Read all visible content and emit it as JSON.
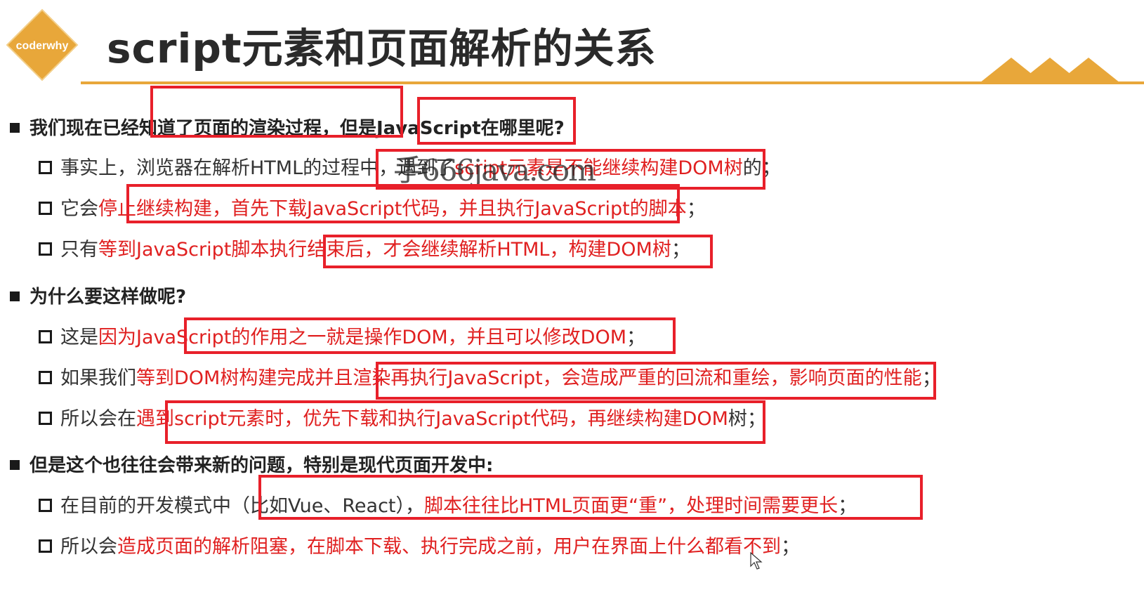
{
  "header": {
    "logo_text": "coderwhy",
    "title": "script元素和页面解析的关系"
  },
  "bullets": [
    {
      "text": "我们现在已经知道了页面的渲染过程，但是JavaScript在哪里呢?",
      "subs": [
        {
          "segments": [
            {
              "text": "事实上，浏览器在解析HTML的过程中，遇到了",
              "style": "dark"
            },
            {
              "text": "script元素是不能继续构建DOM树",
              "style": "red"
            },
            {
              "text": "的；",
              "style": "dark"
            }
          ]
        },
        {
          "segments": [
            {
              "text": "它会",
              "style": "dark"
            },
            {
              "text": "停止继续构建，首先下载JavaScript代码，并且执行JavaScript的脚本",
              "style": "red"
            },
            {
              "text": "；",
              "style": "dark"
            }
          ]
        },
        {
          "segments": [
            {
              "text": "只有",
              "style": "dark"
            },
            {
              "text": "等到JavaScript脚本执行结束后，才会继续解析HTML，构建DOM树",
              "style": "red"
            },
            {
              "text": "；",
              "style": "dark"
            }
          ]
        }
      ]
    },
    {
      "text": "为什么要这样做呢?",
      "subs": [
        {
          "segments": [
            {
              "text": "这是",
              "style": "dark"
            },
            {
              "text": "因为JavaScript的作用之一就是操作DOM，并且可以修改DOM",
              "style": "red"
            },
            {
              "text": "；",
              "style": "dark"
            }
          ]
        },
        {
          "segments": [
            {
              "text": "如果我们",
              "style": "dark"
            },
            {
              "text": "等到DOM树构建完成并且渲染再执行JavaScript，会造成严重的回流和重绘，影响页面的性能",
              "style": "red"
            },
            {
              "text": "；",
              "style": "dark"
            }
          ]
        },
        {
          "segments": [
            {
              "text": "所以会在",
              "style": "dark"
            },
            {
              "text": "遇到script元素时，优先下载和执行JavaScript代码，再继续构建DOM",
              "style": "red"
            },
            {
              "text": "树；",
              "style": "dark"
            }
          ]
        }
      ]
    },
    {
      "text": "但是这个也往往会带来新的问题，特别是现代页面开发中:",
      "subs": [
        {
          "segments": [
            {
              "text": "在目前的开发模式中（比如Vue、React），",
              "style": "dark"
            },
            {
              "text": "脚本往往比HTML页面更“重”，处理时间需要更长",
              "style": "red"
            },
            {
              "text": "；",
              "style": "dark"
            }
          ]
        },
        {
          "segments": [
            {
              "text": "所以会",
              "style": "dark"
            },
            {
              "text": "造成页面的解析阻塞，在脚本下载、执行完成之前，用户在界面上什么都看不到",
              "style": "red"
            },
            {
              "text": "；",
              "style": "dark"
            }
          ]
        }
      ]
    }
  ],
  "watermark": "手666java.com",
  "colors": {
    "accent": "#e8a73a",
    "highlight_text": "#e02020",
    "annotation_box": "#e8202a"
  }
}
